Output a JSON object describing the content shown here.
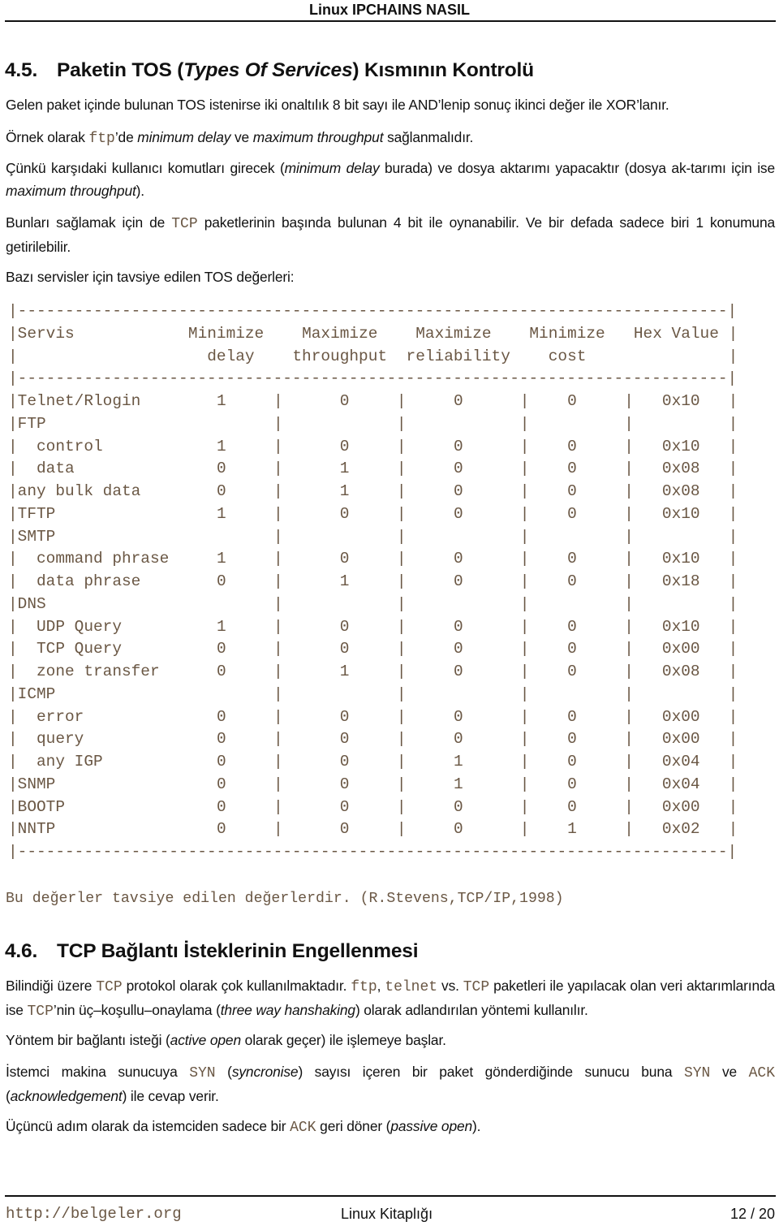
{
  "running_header": "Linux IPCHAINS NASIL",
  "section_45": {
    "number": "4.5.",
    "title_segments": [
      {
        "t": "Paketin TOS ("
      },
      {
        "t": "Types Of Services",
        "s": "it"
      },
      {
        "t": ") Kısmının Kontrolü"
      }
    ],
    "paragraphs": [
      [
        {
          "t": "Gelen paket içinde bulunan TOS istenirse iki onaltılık 8 bit sayı ile AND’lenip sonuç ikinci değer ile XOR’lanır."
        }
      ],
      [
        {
          "t": "Örnek olarak "
        },
        {
          "t": "ftp",
          "s": "code"
        },
        {
          "t": "’de "
        },
        {
          "t": "minimum delay",
          "s": "it"
        },
        {
          "t": " ve "
        },
        {
          "t": "maximum throughput",
          "s": "it"
        },
        {
          "t": " sağlanmalıdır."
        }
      ],
      [
        {
          "t": "Çünkü karşıdaki kullanıcı komutları girecek ("
        },
        {
          "t": "minimum delay",
          "s": "it"
        },
        {
          "t": " burada) ve dosya aktarımı yapacaktır (dosya ak-tarımı için ise "
        },
        {
          "t": "maximum throughput",
          "s": "it"
        },
        {
          "t": ")."
        }
      ],
      [
        {
          "t": "Bunları sağlamak için de "
        },
        {
          "t": "TCP",
          "s": "code"
        },
        {
          "t": " paketlerinin başında bulunan 4 bit ile oynanabilir. Ve bir defada sadece biri 1 konumuna getirilebilir."
        }
      ],
      [
        {
          "t": "Bazı servisler için tavsiye edilen TOS değerleri:"
        }
      ]
    ]
  },
  "tos_table": {
    "header_line1": [
      "Servis",
      "Minimize",
      "Maximize",
      "Maximize",
      "Minimize",
      "Hex Value"
    ],
    "header_line2": [
      "",
      "delay",
      "throughput",
      "reliability",
      "cost",
      ""
    ],
    "rows": [
      {
        "service": "Telnet/Rlogin",
        "values": [
          "1",
          "0",
          "0",
          "0",
          "0x10"
        ]
      },
      {
        "service": "FTP",
        "values": [
          "",
          "",
          "",
          "",
          ""
        ]
      },
      {
        "service": "  control",
        "values": [
          "1",
          "0",
          "0",
          "0",
          "0x10"
        ]
      },
      {
        "service": "  data",
        "values": [
          "0",
          "1",
          "0",
          "0",
          "0x08"
        ]
      },
      {
        "service": "any bulk data",
        "values": [
          "0",
          "1",
          "0",
          "0",
          "0x08"
        ]
      },
      {
        "service": "TFTP",
        "values": [
          "1",
          "0",
          "0",
          "0",
          "0x10"
        ]
      },
      {
        "service": "SMTP",
        "values": [
          "",
          "",
          "",
          "",
          ""
        ]
      },
      {
        "service": "  command phrase",
        "values": [
          "1",
          "0",
          "0",
          "0",
          "0x10"
        ]
      },
      {
        "service": "  data phrase",
        "values": [
          "0",
          "1",
          "0",
          "0",
          "0x18"
        ]
      },
      {
        "service": "DNS",
        "values": [
          "",
          "",
          "",
          "",
          ""
        ]
      },
      {
        "service": "  UDP Query",
        "values": [
          "1",
          "0",
          "0",
          "0",
          "0x10"
        ]
      },
      {
        "service": "  TCP Query",
        "values": [
          "0",
          "0",
          "0",
          "0",
          "0x00"
        ]
      },
      {
        "service": "  zone transfer",
        "values": [
          "0",
          "1",
          "0",
          "0",
          "0x08"
        ]
      },
      {
        "service": "ICMP",
        "values": [
          "",
          "",
          "",
          "",
          ""
        ]
      },
      {
        "service": "  error",
        "values": [
          "0",
          "0",
          "0",
          "0",
          "0x00"
        ]
      },
      {
        "service": "  query",
        "values": [
          "0",
          "0",
          "0",
          "0",
          "0x00"
        ]
      },
      {
        "service": "  any IGP",
        "values": [
          "0",
          "0",
          "1",
          "0",
          "0x04"
        ]
      },
      {
        "service": "SNMP",
        "values": [
          "0",
          "0",
          "1",
          "0",
          "0x04"
        ]
      },
      {
        "service": "BOOTP",
        "values": [
          "0",
          "0",
          "0",
          "0",
          "0x00"
        ]
      },
      {
        "service": "NNTP",
        "values": [
          "0",
          "0",
          "0",
          "1",
          "0x02"
        ]
      }
    ]
  },
  "table_note": "Bu değerler tavsiye edilen değerlerdir. (R.Stevens,TCP/IP,1998)",
  "section_46": {
    "number": "4.6.",
    "title_segments": [
      {
        "t": "TCP Bağlantı İsteklerinin Engellenmesi"
      }
    ],
    "paragraphs": [
      [
        {
          "t": "Bilindiği üzere "
        },
        {
          "t": "TCP",
          "s": "code"
        },
        {
          "t": " protokol olarak çok kullanılmaktadır. "
        },
        {
          "t": "ftp",
          "s": "code"
        },
        {
          "t": ", "
        },
        {
          "t": "telnet",
          "s": "code"
        },
        {
          "t": " vs. "
        },
        {
          "t": "TCP",
          "s": "code"
        },
        {
          "t": " paketleri ile yapılacak olan veri aktarımlarında ise "
        },
        {
          "t": "TCP",
          "s": "code"
        },
        {
          "t": "’nin üç–koşullu–onaylama ("
        },
        {
          "t": "three way hanshaking",
          "s": "it"
        },
        {
          "t": ") olarak adlandırılan yöntemi kullanılır."
        }
      ],
      [
        {
          "t": "Yöntem bir bağlantı isteği ("
        },
        {
          "t": "active open",
          "s": "it"
        },
        {
          "t": " olarak geçer) ile işlemeye başlar."
        }
      ],
      [
        {
          "t": "İstemci makina sunucuya "
        },
        {
          "t": "SYN",
          "s": "code"
        },
        {
          "t": " ("
        },
        {
          "t": "syncronise",
          "s": "it"
        },
        {
          "t": ") sayısı içeren bir paket gönderdiğinde sunucu buna "
        },
        {
          "t": "SYN",
          "s": "code"
        },
        {
          "t": " ve "
        },
        {
          "t": "ACK",
          "s": "code"
        },
        {
          "t": " ("
        },
        {
          "t": "acknowledgement",
          "s": "it"
        },
        {
          "t": ") ile cevap verir."
        }
      ],
      [
        {
          "t": "Üçüncü adım olarak da istemciden sadece bir "
        },
        {
          "t": "ACK",
          "s": "code"
        },
        {
          "t": " geri döner ("
        },
        {
          "t": "passive open",
          "s": "it"
        },
        {
          "t": ")."
        }
      ]
    ]
  },
  "footer": {
    "url": "http://belgeler.org",
    "center": "Linux Kitaplığı",
    "page": "12 / 20"
  }
}
